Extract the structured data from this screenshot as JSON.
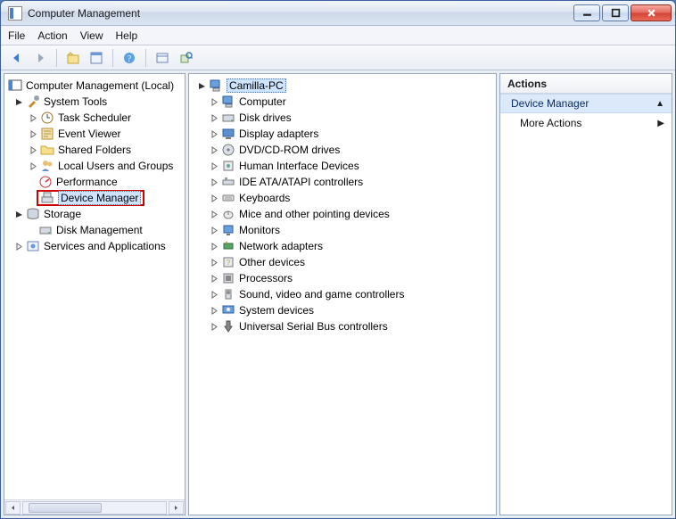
{
  "window": {
    "title": "Computer Management"
  },
  "menu": {
    "file": "File",
    "action": "Action",
    "view": "View",
    "help": "Help"
  },
  "leftTree": {
    "root": "Computer Management (Local)",
    "systemTools": "System Tools",
    "taskScheduler": "Task Scheduler",
    "eventViewer": "Event Viewer",
    "sharedFolders": "Shared Folders",
    "localUsers": "Local Users and Groups",
    "performance": "Performance",
    "deviceManager": "Device Manager",
    "storage": "Storage",
    "diskManagement": "Disk Management",
    "servicesApps": "Services and Applications"
  },
  "middleTree": {
    "root": "Camilla-PC",
    "items": [
      "Computer",
      "Disk drives",
      "Display adapters",
      "DVD/CD-ROM drives",
      "Human Interface Devices",
      "IDE ATA/ATAPI controllers",
      "Keyboards",
      "Mice and other pointing devices",
      "Monitors",
      "Network adapters",
      "Other devices",
      "Processors",
      "Sound, video and game controllers",
      "System devices",
      "Universal Serial Bus controllers"
    ]
  },
  "actions": {
    "header": "Actions",
    "section": "Device Manager",
    "more": "More Actions"
  }
}
